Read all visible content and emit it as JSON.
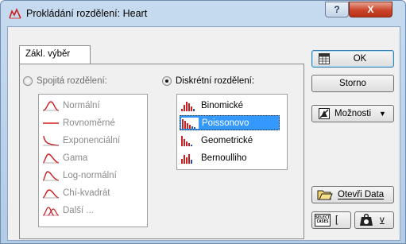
{
  "window": {
    "title": "Prokládání rozdělení: Heart",
    "help_label": "?",
    "close_label": "X"
  },
  "tab": {
    "label": "Zákl. výběr"
  },
  "continuous": {
    "radio_label": "Spojitá rozdělení:",
    "items": [
      "Normální",
      "Rovnoměrné",
      "Exponenciální",
      "Gama",
      "Log-normální",
      "Chí-kvadrát",
      "Další ..."
    ]
  },
  "discrete": {
    "radio_label": "Diskrétní rozdělení:",
    "selected": "Poissonovo",
    "items": [
      "Binomické",
      "Poissonovo",
      "Geometrické",
      "Bernoulliho"
    ]
  },
  "buttons": {
    "ok": "OK",
    "cancel": "Storno",
    "options": "Možnosti",
    "open_data": "Otevři Data",
    "select_cases_icon_text": "SELECT CASES",
    "select_cases_key": "[",
    "weights_key": "v"
  },
  "colors": {
    "selection": "#3399ff",
    "curve_red": "#cc2020",
    "histogram_blue": "#2a4fa0"
  }
}
